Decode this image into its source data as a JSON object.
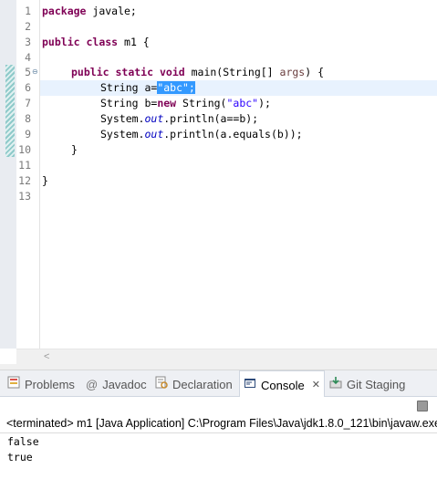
{
  "editor": {
    "line_numbers": [
      "1",
      "2",
      "3",
      "4",
      "5",
      "6",
      "7",
      "8",
      "9",
      "10",
      "11",
      "12",
      "13"
    ],
    "fold_marker": "⊖",
    "lines": {
      "l1": {
        "kw": "package",
        "rest": " javale;"
      },
      "l3": {
        "kw1": "public",
        "kw2": "class",
        "rest": " m1 {"
      },
      "l5": {
        "kw1": "public",
        "kw2": "static",
        "kw3": "void",
        "mid": " main(String[] ",
        "param": "args",
        "end": ") {"
      },
      "l6": {
        "pre": "String a=",
        "sel": "\"abc\";"
      },
      "l7": {
        "pre": "String b=",
        "kw": "new",
        "mid": " String(",
        "str": "\"abc\"",
        "end": ");"
      },
      "l8": {
        "pre": "System.",
        "field": "out",
        "end": ".println(a==b);"
      },
      "l9": {
        "pre": "System.",
        "field": "out",
        "end": ".println(a.equals(b));"
      },
      "l10": "}",
      "l12": "}"
    },
    "scroll_left_arrow": "<"
  },
  "tabs": [
    {
      "label": "Problems",
      "icon": "problems-icon",
      "active": false
    },
    {
      "label": "Javadoc",
      "icon": "javadoc-icon",
      "active": false
    },
    {
      "label": "Declaration",
      "icon": "declaration-icon",
      "active": false
    },
    {
      "label": "Console",
      "icon": "console-icon",
      "active": true,
      "close": "✕"
    },
    {
      "label": "Git Staging",
      "icon": "git-staging-icon",
      "active": false
    }
  ],
  "console": {
    "header": "<terminated> m1 [Java Application] C:\\Program Files\\Java\\jdk1.8.0_121\\bin\\javaw.exe",
    "output": [
      "false",
      "true"
    ]
  },
  "colors": {
    "keyword": "#7f0055",
    "string": "#2a00ff",
    "field": "#0000c0",
    "selection": "#3399ff",
    "current_line": "#e8f2fe"
  }
}
